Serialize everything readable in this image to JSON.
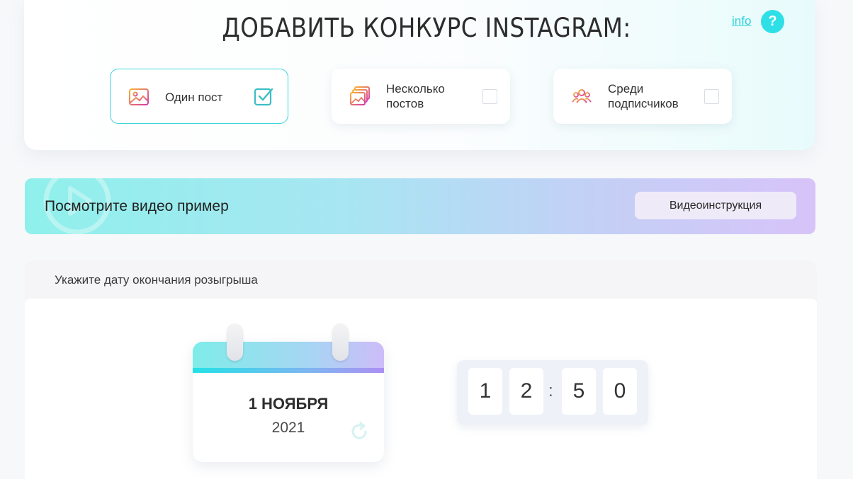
{
  "header": {
    "title": "ДОБАВИТЬ КОНКУРС INSTAGRAM:",
    "info_link": "info",
    "help_symbol": "?"
  },
  "options": [
    {
      "label": "Один пост",
      "icon": "image-icon",
      "checked": true
    },
    {
      "label": "Несколько постов",
      "icon": "images-icon",
      "checked": false
    },
    {
      "label": "Среди подписчиков",
      "icon": "users-icon",
      "checked": false
    }
  ],
  "video_banner": {
    "text": "Посмотрите видео пример",
    "button": "Видеоинструкция"
  },
  "date_section": {
    "label": "Укажите дату окончания розыгрыша",
    "day": "1 НОЯБРЯ",
    "year": "2021",
    "time_digits": [
      "1",
      "2",
      "5",
      "0"
    ],
    "separator": ":"
  },
  "colors": {
    "accent": "#2ad3db",
    "selected_border": "#3ed6dc"
  }
}
